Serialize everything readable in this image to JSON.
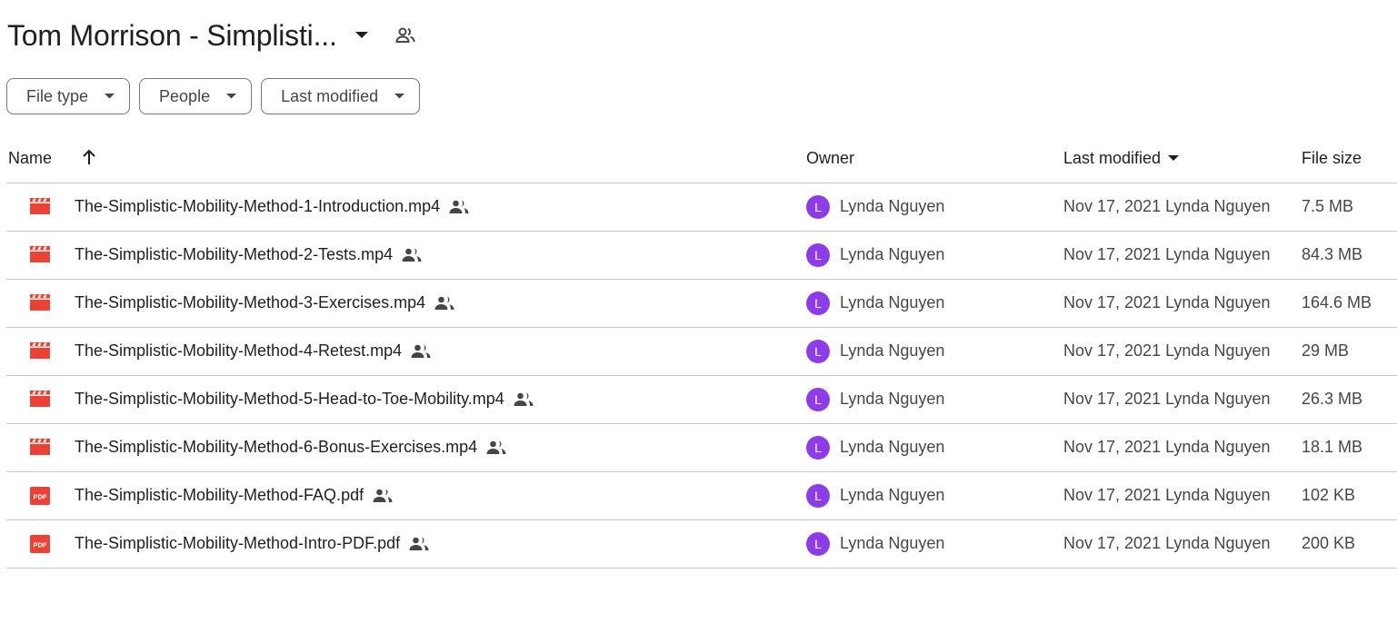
{
  "header": {
    "folder_title": "Tom Morrison - Simplisti...",
    "caret_icon": "arrow-drop-down-icon",
    "shared_icon": "shared-folder-icon"
  },
  "filters": [
    {
      "label": "File type"
    },
    {
      "label": "People"
    },
    {
      "label": "Last modified"
    }
  ],
  "columns": {
    "name": "Name",
    "owner": "Owner",
    "modified": "Last modified",
    "size": "File size"
  },
  "files": [
    {
      "type": "video",
      "name": "The-Simplistic-Mobility-Method-1-Introduction.mp4",
      "owner_initial": "L",
      "owner": "Lynda Nguyen",
      "modified": "Nov 17, 2021 Lynda Nguyen",
      "size": "7.5 MB"
    },
    {
      "type": "video",
      "name": "The-Simplistic-Mobility-Method-2-Tests.mp4",
      "owner_initial": "L",
      "owner": "Lynda Nguyen",
      "modified": "Nov 17, 2021 Lynda Nguyen",
      "size": "84.3 MB"
    },
    {
      "type": "video",
      "name": "The-Simplistic-Mobility-Method-3-Exercises.mp4",
      "owner_initial": "L",
      "owner": "Lynda Nguyen",
      "modified": "Nov 17, 2021 Lynda Nguyen",
      "size": "164.6 MB"
    },
    {
      "type": "video",
      "name": "The-Simplistic-Mobility-Method-4-Retest.mp4",
      "owner_initial": "L",
      "owner": "Lynda Nguyen",
      "modified": "Nov 17, 2021 Lynda Nguyen",
      "size": "29 MB"
    },
    {
      "type": "video",
      "name": "The-Simplistic-Mobility-Method-5-Head-to-Toe-Mobility.mp4",
      "owner_initial": "L",
      "owner": "Lynda Nguyen",
      "modified": "Nov 17, 2021 Lynda Nguyen",
      "size": "26.3 MB"
    },
    {
      "type": "video",
      "name": "The-Simplistic-Mobility-Method-6-Bonus-Exercises.mp4",
      "owner_initial": "L",
      "owner": "Lynda Nguyen",
      "modified": "Nov 17, 2021 Lynda Nguyen",
      "size": "18.1 MB"
    },
    {
      "type": "pdf",
      "name": "The-Simplistic-Mobility-Method-FAQ.pdf",
      "owner_initial": "L",
      "owner": "Lynda Nguyen",
      "modified": "Nov 17, 2021 Lynda Nguyen",
      "size": "102 KB"
    },
    {
      "type": "pdf",
      "name": "The-Simplistic-Mobility-Method-Intro-PDF.pdf",
      "owner_initial": "L",
      "owner": "Lynda Nguyen",
      "modified": "Nov 17, 2021 Lynda Nguyen",
      "size": "200 KB"
    }
  ],
  "colors": {
    "file_icon_red": "#ea4335",
    "avatar_purple": "#8e3ce7",
    "divider": "#c4c7c5"
  }
}
